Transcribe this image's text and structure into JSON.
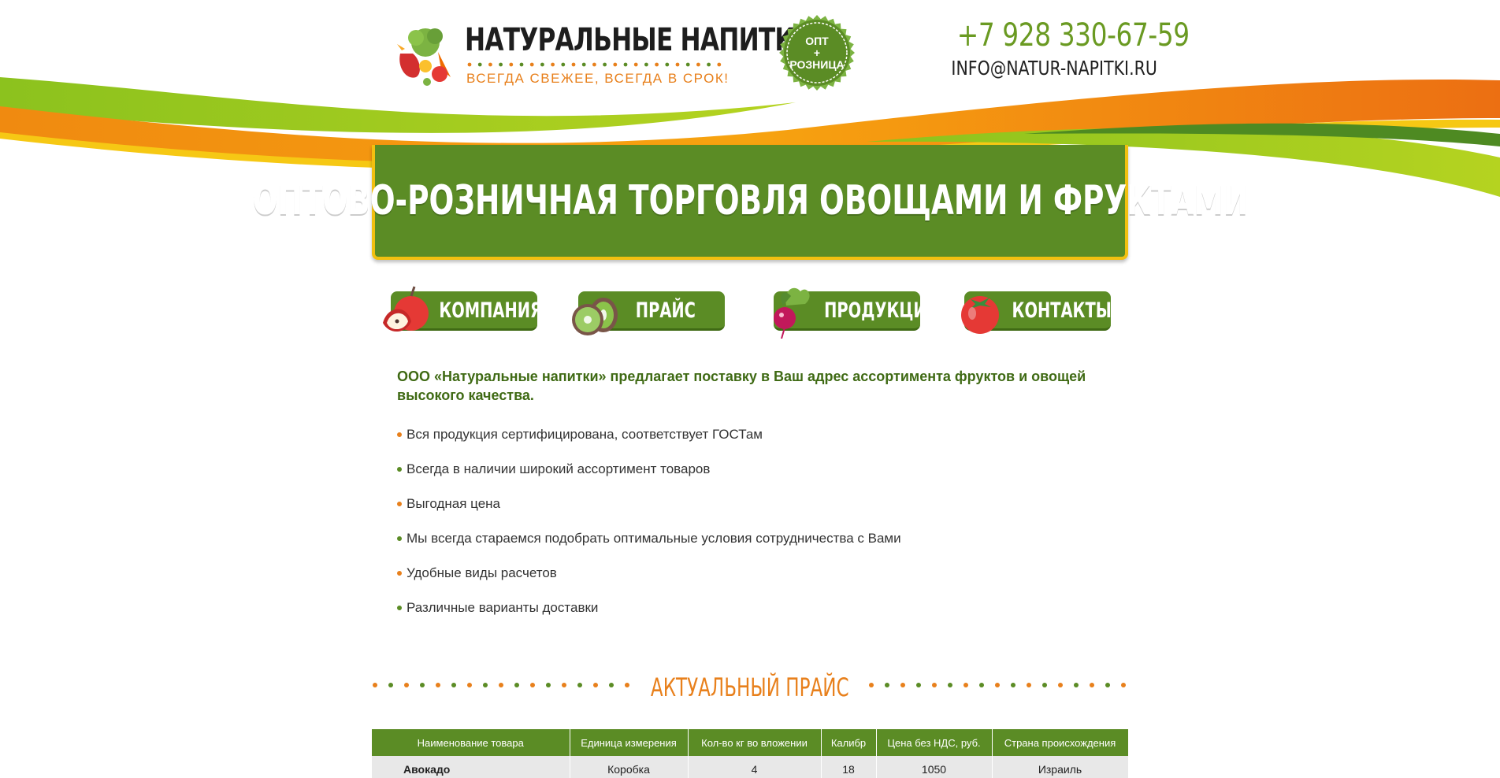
{
  "header": {
    "logo_title": "НАТУРАЛЬНЫЕ НАПИТКИ",
    "logo_subtitle": "ВСЕГДА СВЕЖЕЕ, ВСЕГДА В СРОК!",
    "badge_line1": "ОПТ",
    "badge_line2": "+",
    "badge_line3": "РОЗНИЦА",
    "phone": "+7 928 330-67-59",
    "email": "INFO@NATUR-NAPITKI.RU"
  },
  "banner": {
    "title": "ОПТОВО-РОЗНИЧНАЯ ТОРГОВЛЯ ОВОЩАМИ И ФРУКТАМИ"
  },
  "nav": {
    "items": [
      {
        "label": "КОМПАНИЯ",
        "icon": "apple-icon"
      },
      {
        "label": "ПРАЙС",
        "icon": "kiwi-icon"
      },
      {
        "label": "ПРОДУКЦИЯ",
        "icon": "radish-icon"
      },
      {
        "label": "КОНТАКТЫ",
        "icon": "tomato-icon"
      }
    ]
  },
  "intro": {
    "lead": "ООО «Натуральные напитки» предлагает поставку в Ваш адрес ассортимента фруктов и овощей высокого качества.",
    "features": [
      "Вся продукция сертифицирована, соответствует ГОСТам",
      "Всегда в наличии широкий ассортимент товаров",
      "Выгодная цена",
      "Мы всегда стараемся подобрать оптимальные условия сотрудничества с Вами",
      "Удобные виды расчетов",
      "Различные варианты доставки"
    ]
  },
  "price": {
    "heading": "АКТУАЛЬНЫЙ ПРАЙС",
    "columns": [
      "Наименование товара",
      "Единица измерения",
      "Кол-во кг во вложении",
      "Калибр",
      "Цена без НДС, руб.",
      "Страна происхождения"
    ],
    "rows": [
      [
        "Авокадо",
        "Коробка",
        "4",
        "18",
        "1050",
        "Израиль"
      ]
    ]
  },
  "colors": {
    "brand_green": "#5b8c25",
    "brand_orange": "#e8801c",
    "banner_border": "#f2c010",
    "bullet_orange": "#e8801c",
    "bullet_green": "#5b8c25"
  }
}
